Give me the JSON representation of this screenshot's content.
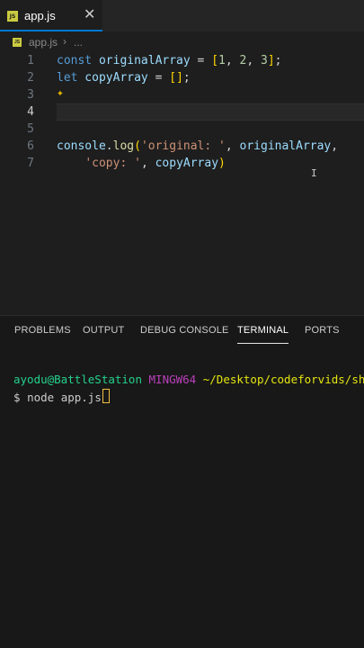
{
  "tab": {
    "badge": "JS",
    "label": "app.js",
    "close": "✕"
  },
  "breadcrumb": {
    "badge": "JS",
    "file": "app.js",
    "sep": "›",
    "rest": "..."
  },
  "editor": {
    "line_numbers": [
      "1",
      "2",
      "3",
      "4",
      "5",
      "6",
      "7"
    ],
    "line1": {
      "kw": "const",
      "name": " originalArray",
      "eq": " = ",
      "open": "[",
      "n1": "1",
      "c1": ", ",
      "n2": "2",
      "c2": ", ",
      "n3": "3",
      "close": "]",
      "end": ";"
    },
    "line2": {
      "kw": "let",
      "name": " copyArray",
      "eq": " = ",
      "open": "[",
      "close": "]",
      "end": ";"
    },
    "line6": {
      "obj": "console",
      "dot": ".",
      "fn": "log",
      "open": "(",
      "s1": "'original: '",
      "c1": ", ",
      "v1": "originalArray",
      "c2": ","
    },
    "line7": {
      "indent": "    ",
      "s2": "'copy: '",
      "c3": ", ",
      "v2": "copyArray",
      "close": ")"
    },
    "sparkle": "✦"
  },
  "panel": {
    "tabs": [
      "PROBLEMS",
      "OUTPUT",
      "DEBUG CONSOLE",
      "TERMINAL",
      "PORTS"
    ],
    "active_tab": "TERMINAL",
    "terminal": {
      "user": "ayodu@BattleStation",
      "host": "MINGW64",
      "path": "~/Desktop/codeforvids/sho",
      "prompt": "$ ",
      "command": "node app.js"
    }
  }
}
